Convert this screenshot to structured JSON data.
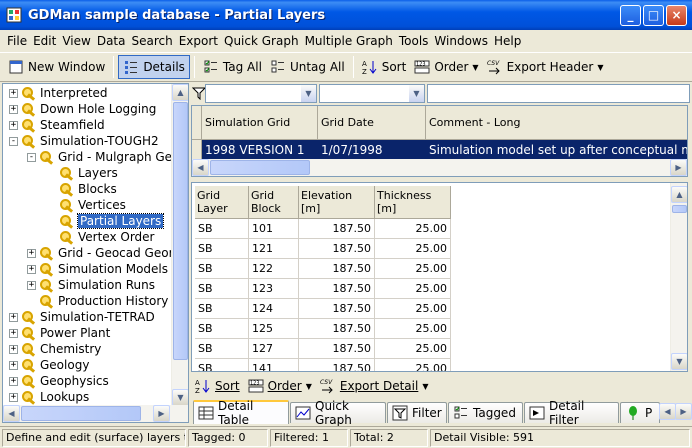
{
  "window": {
    "title": "GDMan sample database - Partial Layers",
    "min": "_",
    "max": "□",
    "close": "×"
  },
  "menu": [
    "File",
    "Edit",
    "View",
    "Data",
    "Search",
    "Export",
    "Quick Graph",
    "Multiple Graph",
    "Tools",
    "Windows",
    "Help"
  ],
  "toolbar": {
    "new_window": "New Window",
    "details": "Details",
    "tag_all": "Tag All",
    "untag_all": "Untag All",
    "sort": "Sort",
    "order": "Order",
    "export_header": "Export Header",
    "csv": "CSV"
  },
  "tree": [
    {
      "label": "Interpreted",
      "level": 0,
      "expander": "+"
    },
    {
      "label": "Down Hole Logging",
      "level": 0,
      "expander": "+"
    },
    {
      "label": "Steamfield",
      "level": 0,
      "expander": "+"
    },
    {
      "label": "Simulation-TOUGH2",
      "level": 0,
      "expander": "-"
    },
    {
      "label": "Grid - Mulgraph Ge",
      "level": 1,
      "expander": "-"
    },
    {
      "label": "Layers",
      "level": 2,
      "expander": ""
    },
    {
      "label": "Blocks",
      "level": 2,
      "expander": ""
    },
    {
      "label": "Vertices",
      "level": 2,
      "expander": ""
    },
    {
      "label": "Partial Layers",
      "level": 2,
      "expander": "",
      "selected": true
    },
    {
      "label": "Vertex Order",
      "level": 2,
      "expander": ""
    },
    {
      "label": "Grid - Geocad Geor",
      "level": 1,
      "expander": "+"
    },
    {
      "label": "Simulation Models",
      "level": 1,
      "expander": "+"
    },
    {
      "label": "Simulation Runs",
      "level": 1,
      "expander": "+"
    },
    {
      "label": "Production History",
      "level": 1,
      "expander": ""
    },
    {
      "label": "Simulation-TETRAD",
      "level": 0,
      "expander": "+"
    },
    {
      "label": "Power Plant",
      "level": 0,
      "expander": "+"
    },
    {
      "label": "Chemistry",
      "level": 0,
      "expander": "+"
    },
    {
      "label": "Geology",
      "level": 0,
      "expander": "+"
    },
    {
      "label": "Geophysics",
      "level": 0,
      "expander": "+"
    },
    {
      "label": "Lookups",
      "level": 0,
      "expander": "+"
    }
  ],
  "header_grid": {
    "columns": [
      "Simulation Grid",
      "Grid Date",
      "Comment - Long"
    ],
    "row": [
      "1998 VERSION 1",
      "1/07/1998",
      "Simulation model set up after conceptual mode"
    ]
  },
  "detail_grid": {
    "columns": [
      "Grid Layer",
      "Grid Block",
      "Elevation [m]",
      "Thickness [m]"
    ],
    "rows": [
      [
        "SB",
        "101",
        "187.50",
        "25.00"
      ],
      [
        "SB",
        "121",
        "187.50",
        "25.00"
      ],
      [
        "SB",
        "122",
        "187.50",
        "25.00"
      ],
      [
        "SB",
        "123",
        "187.50",
        "25.00"
      ],
      [
        "SB",
        "124",
        "187.50",
        "25.00"
      ],
      [
        "SB",
        "125",
        "187.50",
        "25.00"
      ],
      [
        "SB",
        "127",
        "187.50",
        "25.00"
      ],
      [
        "SB",
        "141",
        "187.50",
        "25.00"
      ]
    ]
  },
  "detail_toolbar": {
    "sort": "Sort",
    "order": "Order",
    "export_detail": "Export Detail",
    "csv": "CSV"
  },
  "tabs": [
    "Detail Table",
    "Quick Graph",
    "Filter",
    "Tagged",
    "Detail Filter",
    "P"
  ],
  "status": {
    "hint": "Define and edit (surface) layers that o",
    "tagged": "Tagged: 0",
    "filtered": "Filtered: 1",
    "total": "Total: 2",
    "detail_visible": "Detail Visible: 591"
  },
  "colors": {
    "selection": "#316ac5",
    "selected_row": "#0a246a",
    "title_bar": "#0058e6"
  }
}
